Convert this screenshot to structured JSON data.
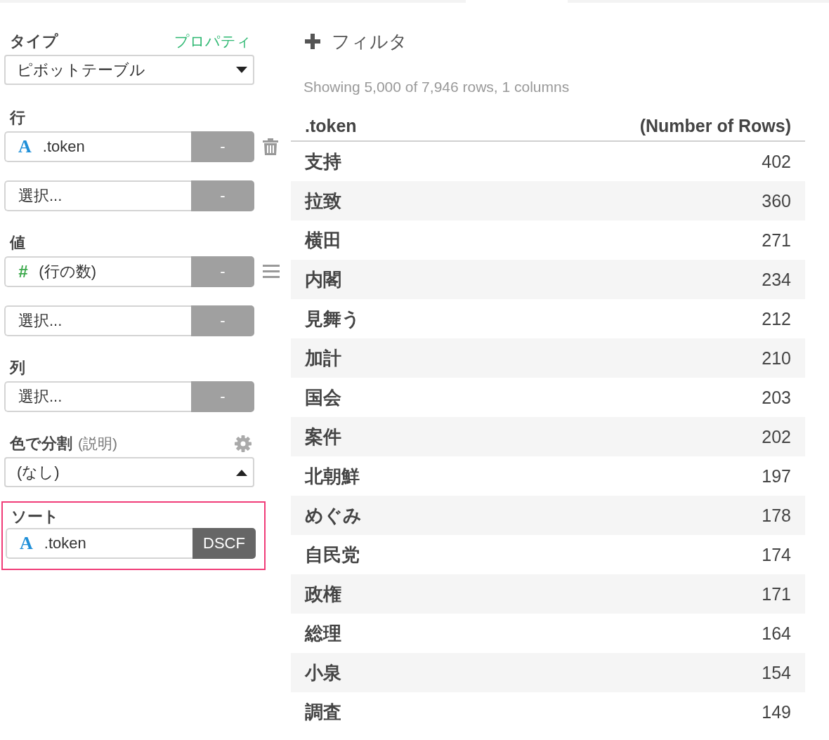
{
  "type_section": {
    "label": "タイプ",
    "link": "プロパティ",
    "select": {
      "value": "ピボットテーブル",
      "open": false
    }
  },
  "sections": [
    {
      "label": "行",
      "fields": [
        {
          "kind": "text",
          "type_icon": "A",
          "value": ".token",
          "button": "-",
          "button_active": false,
          "deletable": true
        },
        {
          "kind": "empty",
          "placeholder": "選択...",
          "button": "-",
          "button_active": false
        }
      ]
    },
    {
      "label": "値",
      "fields": [
        {
          "kind": "number",
          "type_icon": "#",
          "value": "(行の数)",
          "button": "-",
          "button_active": false,
          "reorderable": true
        },
        {
          "kind": "empty",
          "placeholder": "選択...",
          "button": "-",
          "button_active": false
        }
      ]
    },
    {
      "label": "列",
      "fields": [
        {
          "kind": "empty",
          "placeholder": "選択...",
          "button": "-",
          "button_active": false
        }
      ]
    }
  ],
  "color_section": {
    "label": "色で分割",
    "note": "(説明)",
    "select": {
      "value": "(なし)",
      "open": true
    }
  },
  "sort_section": {
    "label": "ソート",
    "highlighted": true,
    "fields": [
      {
        "kind": "text",
        "type_icon": "A",
        "value": ".token",
        "button": "DSCF",
        "button_active": true
      }
    ]
  },
  "filter": {
    "label": "フィルタ"
  },
  "summary": "Showing 5,000 of 7,946 rows, 1 columns",
  "table": {
    "columns": [
      ".token",
      "(Number of Rows)"
    ],
    "rows": [
      [
        "支持",
        "402"
      ],
      [
        "拉致",
        "360"
      ],
      [
        "横田",
        "271"
      ],
      [
        "内閣",
        "234"
      ],
      [
        "見舞う",
        "212"
      ],
      [
        "加計",
        "210"
      ],
      [
        "国会",
        "203"
      ],
      [
        "案件",
        "202"
      ],
      [
        "北朝鮮",
        "197"
      ],
      [
        "めぐみ",
        "178"
      ],
      [
        "自民党",
        "174"
      ],
      [
        "政権",
        "171"
      ],
      [
        "総理",
        "164"
      ],
      [
        "小泉",
        "154"
      ],
      [
        "調査",
        "149"
      ]
    ]
  }
}
